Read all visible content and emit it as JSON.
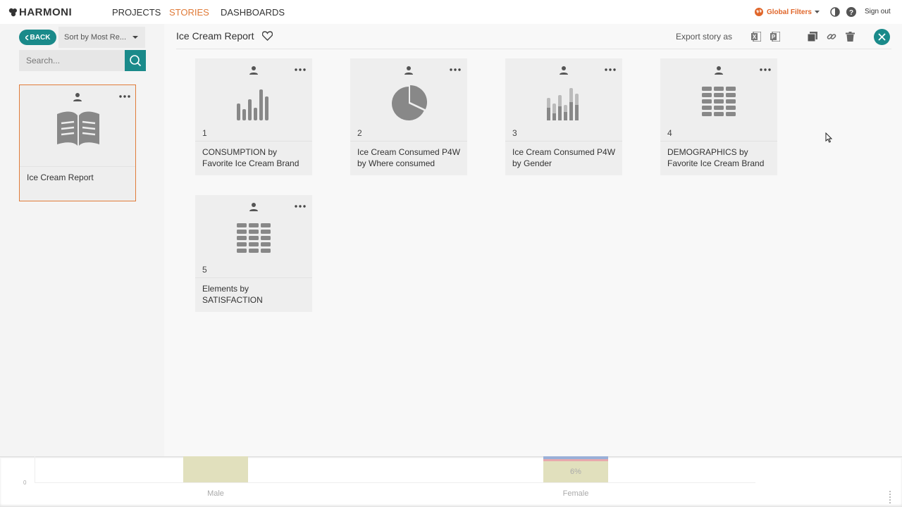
{
  "app": {
    "logo_text": "HARMONI"
  },
  "nav": {
    "projects": "PROJECTS",
    "stories": "STORIES",
    "dashboards": "DASHBOARDS"
  },
  "topbar": {
    "global_filters": "Global Filters",
    "sign_out": "Sign out"
  },
  "sidebar": {
    "back_label": "BACK",
    "sort_label": "Sort by Most Re...",
    "search_placeholder": "Search...",
    "story": {
      "title": "Ice Cream Report"
    }
  },
  "report": {
    "title": "Ice Cream Report",
    "export_label": "Export story as"
  },
  "cards": [
    {
      "number": "1",
      "title": "CONSUMPTION by Favorite Ice Cream Brand",
      "icon": "bar-chart-icon"
    },
    {
      "number": "2",
      "title": "Ice Cream Consumed P4W by Where consumed",
      "icon": "pie-chart-icon"
    },
    {
      "number": "3",
      "title": "Ice Cream Consumed P4W by Gender",
      "icon": "stacked-bar-chart-icon"
    },
    {
      "number": "4",
      "title": "DEMOGRAPHICS by Favorite Ice Cream Brand",
      "icon": "table-icon"
    },
    {
      "number": "5",
      "title": "Elements by SATISFACTION",
      "icon": "table-icon"
    }
  ],
  "background_chart": {
    "axis_zero": "0",
    "categories": [
      "Male",
      "Female"
    ],
    "female_label": "6%"
  },
  "colors": {
    "accent": "#1a8a8a",
    "active_nav": "#e07b39",
    "global_filters": "#e0662a"
  }
}
